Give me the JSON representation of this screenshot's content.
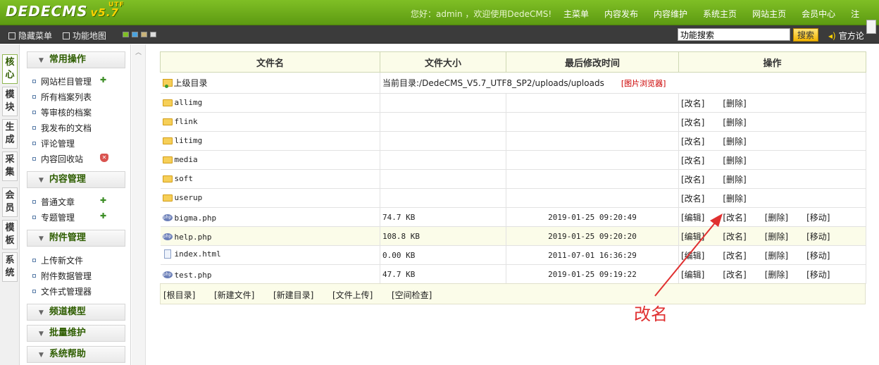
{
  "header": {
    "logo_text": "DEDECMS",
    "logo_version": "v5.7",
    "logo_tag": "UTF",
    "greeting": "您好：admin ，欢迎使用DedeCMS!",
    "nav": [
      "主菜单",
      "内容发布",
      "内容维护",
      "系统主页",
      "网站主页",
      "会员中心",
      "注"
    ]
  },
  "toolbar": {
    "hide_menu": "隐藏菜单",
    "site_map": "功能地图",
    "search_value": "功能搜索",
    "search_button": "搜索",
    "forum_link": "官方论"
  },
  "vtabs": [
    "核心",
    "模块",
    "生成",
    "采集",
    "会员",
    "模板",
    "系统"
  ],
  "sidebar": {
    "sections": [
      {
        "title": "常用操作",
        "items": [
          "网站栏目管理",
          "所有档案列表",
          "等审核的档案",
          "我发布的文档",
          "评论管理",
          "内容回收站"
        ]
      },
      {
        "title": "内容管理",
        "items": [
          "普通文章",
          "专题管理"
        ]
      },
      {
        "title": "附件管理",
        "items": [
          "上传新文件",
          "附件数据管理",
          "文件式管理器"
        ]
      },
      {
        "title": "频道模型",
        "items": []
      },
      {
        "title": "批量维护",
        "items": []
      },
      {
        "title": "系统帮助",
        "items": []
      }
    ]
  },
  "table": {
    "headers": [
      "文件名",
      "文件大小",
      "最后修改时间",
      "操作"
    ],
    "updir": {
      "name": "上级目录",
      "current_label": "当前目录:/DedeCMS_V5.7_UTF8_SP2/uploads/uploads",
      "browser_link": "[图片浏览器]"
    },
    "folders": [
      {
        "name": "allimg"
      },
      {
        "name": "flink"
      },
      {
        "name": "litimg"
      },
      {
        "name": "media"
      },
      {
        "name": "soft"
      },
      {
        "name": "userup"
      }
    ],
    "folder_actions": [
      "[改名]",
      "[删除]"
    ],
    "files": [
      {
        "name": "bigma.php",
        "size": "74.7 KB",
        "mtime": "2019-01-25 09:20:49",
        "kind": "php"
      },
      {
        "name": "help.php",
        "size": "108.8 KB",
        "mtime": "2019-01-25 09:20:20",
        "kind": "php"
      },
      {
        "name": "index.html",
        "size": "0.00 KB",
        "mtime": "2011-07-01 16:36:29",
        "kind": "html"
      },
      {
        "name": "test.php",
        "size": "47.7 KB",
        "mtime": "2019-01-25 09:19:22",
        "kind": "php"
      }
    ],
    "file_actions": [
      "[编辑]",
      "[改名]",
      "[删除]",
      "[移动]"
    ],
    "footer_links": [
      "[根目录]",
      "[新建文件]",
      "[新建目录]",
      "[文件上传]",
      "[空间检查]"
    ]
  },
  "annotation": {
    "text": "改名",
    "color": "#e03030"
  }
}
